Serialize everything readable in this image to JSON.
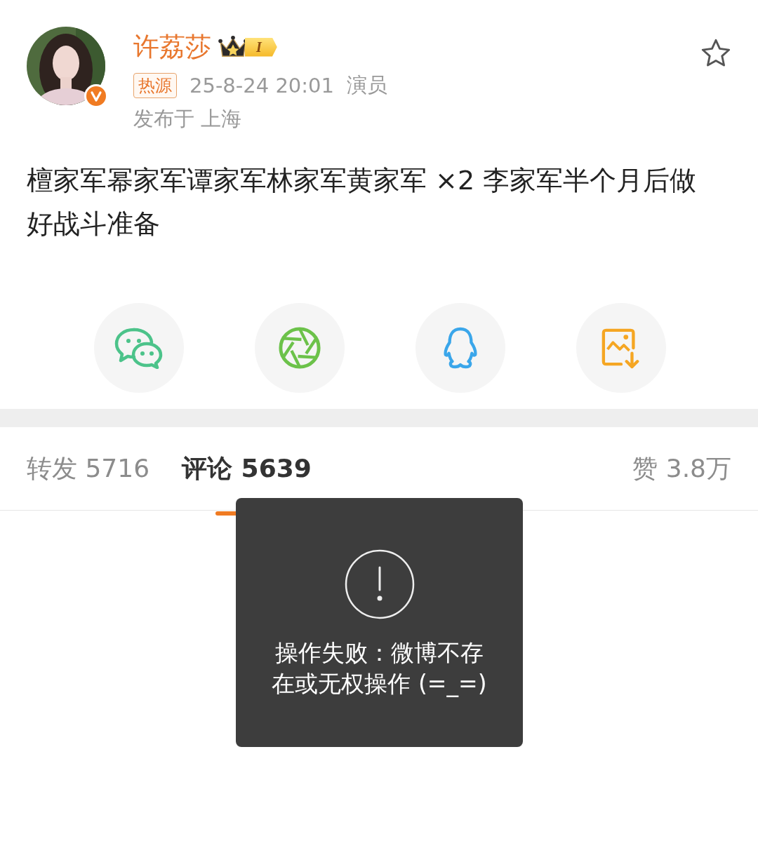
{
  "author": {
    "name": "许荔莎",
    "level_badge": "I",
    "verified": true,
    "tag": "热源",
    "time": "25-8-24 20:01",
    "title": "演员",
    "location": "发布于 上海",
    "favorited": false
  },
  "post": {
    "text": "檀家军幂家军谭家军林家军黄家军 ×2 李家军半个月后做好战斗准备"
  },
  "share_buttons": [
    {
      "kind": "chat"
    },
    {
      "kind": "moments"
    },
    {
      "kind": "qq"
    },
    {
      "kind": "save-image"
    }
  ],
  "tabs": [
    {
      "label": "转发",
      "count": "5716",
      "selected": false
    },
    {
      "label": "评论",
      "count": "5639",
      "selected": true
    }
  ],
  "likes": {
    "label": "赞",
    "count": "3.8万"
  },
  "toast": {
    "message": "操作失败：微博不存在或无权操作 (=_=)"
  }
}
